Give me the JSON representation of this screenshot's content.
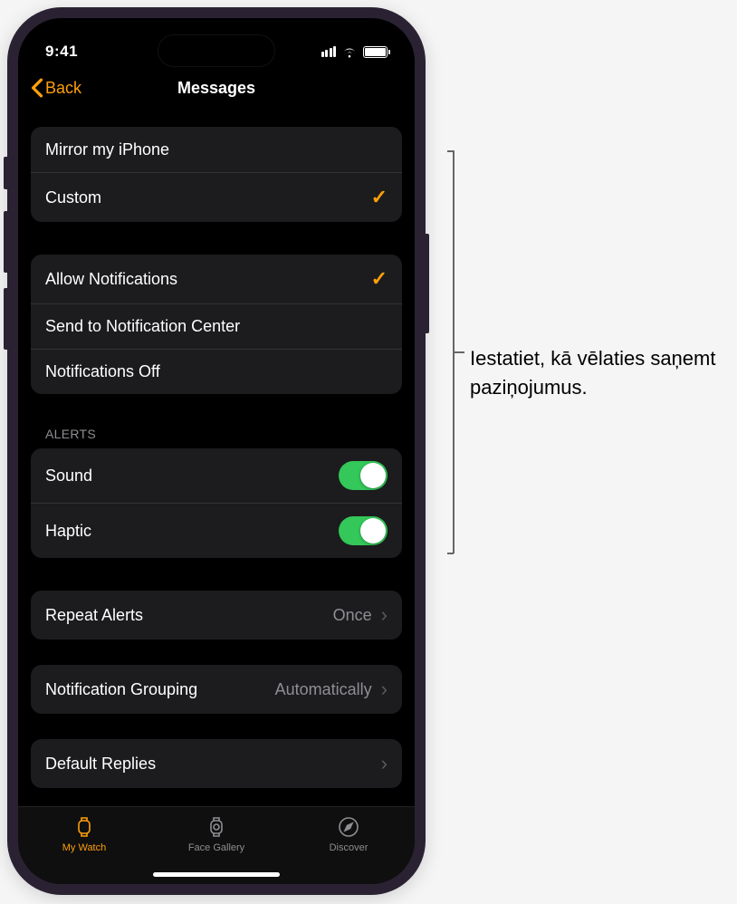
{
  "status": {
    "time": "9:41"
  },
  "nav": {
    "back": "Back",
    "title": "Messages"
  },
  "group1": {
    "mirror": "Mirror my iPhone",
    "custom": "Custom"
  },
  "group2": {
    "allow": "Allow Notifications",
    "send": "Send to Notification Center",
    "off": "Notifications Off"
  },
  "alerts_header": "ALERTS",
  "alerts": {
    "sound": "Sound",
    "haptic": "Haptic"
  },
  "repeat": {
    "label": "Repeat Alerts",
    "value": "Once"
  },
  "grouping": {
    "label": "Notification Grouping",
    "value": "Automatically"
  },
  "replies": {
    "label": "Default Replies"
  },
  "tabs": {
    "watch": "My Watch",
    "gallery": "Face Gallery",
    "discover": "Discover"
  },
  "callout": "Iestatiet, kā vēlaties saņemt paziņojumus."
}
